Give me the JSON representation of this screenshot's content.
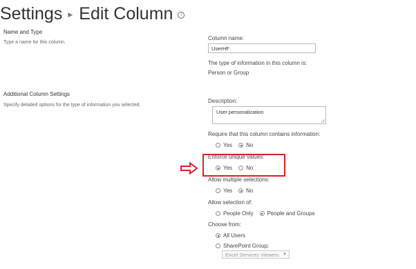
{
  "header": {
    "crumb": "Settings",
    "title": "Edit Column"
  },
  "name_type": {
    "heading": "Name and Type",
    "desc": "Type a name for this column.",
    "column_name_label": "Column name:",
    "column_name_value": "UserHF",
    "type_label": "The type of information in this column is:",
    "type_value": "Person or Group"
  },
  "additional": {
    "heading": "Additional Column Settings",
    "desc": "Specify detailed options for the type of information you selected.",
    "description_label": "Description:",
    "description_value": "User personalization"
  },
  "require_info": {
    "label": "Require that this column contains information:",
    "yes": "Yes",
    "no": "No",
    "selected": "no"
  },
  "enforce_unique": {
    "label": "Enforce unique values:",
    "yes": "Yes",
    "no": "No",
    "selected": "yes"
  },
  "allow_multiple": {
    "label": "Allow multiple selections:",
    "yes": "Yes",
    "no": "No",
    "selected": "no"
  },
  "allow_selection": {
    "label": "Allow selection of:",
    "people_only": "People Only",
    "people_groups": "People and Groups",
    "selected": "people_groups"
  },
  "choose_from": {
    "label": "Choose from:",
    "all_users": "All Users",
    "sp_group": "SharePoint Group:",
    "group_value": "Excel Services Viewers",
    "selected": "all_users"
  },
  "colors": {
    "highlight": "#e01b24"
  }
}
